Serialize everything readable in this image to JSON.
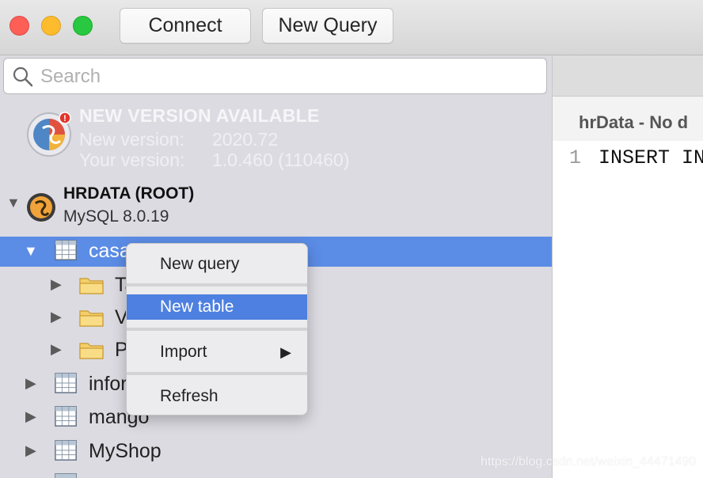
{
  "toolbar": {
    "connect_label": "Connect",
    "new_query_label": "New Query"
  },
  "search": {
    "placeholder": "Search"
  },
  "update_banner": {
    "title": "NEW VERSION AVAILABLE",
    "new_version_label": "New version:",
    "new_version_value": "2020.72",
    "your_version_label": "Your version:",
    "your_version_value": "1.0.460 (110460)"
  },
  "server": {
    "name": "HRDATA (ROOT)",
    "version": "MySQL 8.0.19"
  },
  "databases": [
    {
      "label": "casa",
      "expanded": true,
      "selected": true
    },
    {
      "label": "infor"
    },
    {
      "label": "mango"
    },
    {
      "label": "MyShop"
    }
  ],
  "casa_children": [
    {
      "label": "Ta"
    },
    {
      "label": "V"
    },
    {
      "label": "P"
    }
  ],
  "context_menu": {
    "items": [
      "New query",
      "New table",
      "Import",
      "Refresh"
    ],
    "highlighted": "New table"
  },
  "editor": {
    "crumb": "hrData - No d",
    "line_number": "1",
    "code": "INSERT IN"
  },
  "watermark": "https://blog.csdn.net/weixin_44471490",
  "colors": {
    "selection": "#5b8ce6",
    "menu_highlight": "#4d80e0",
    "sidebar_bg": "#dcdbe2"
  }
}
